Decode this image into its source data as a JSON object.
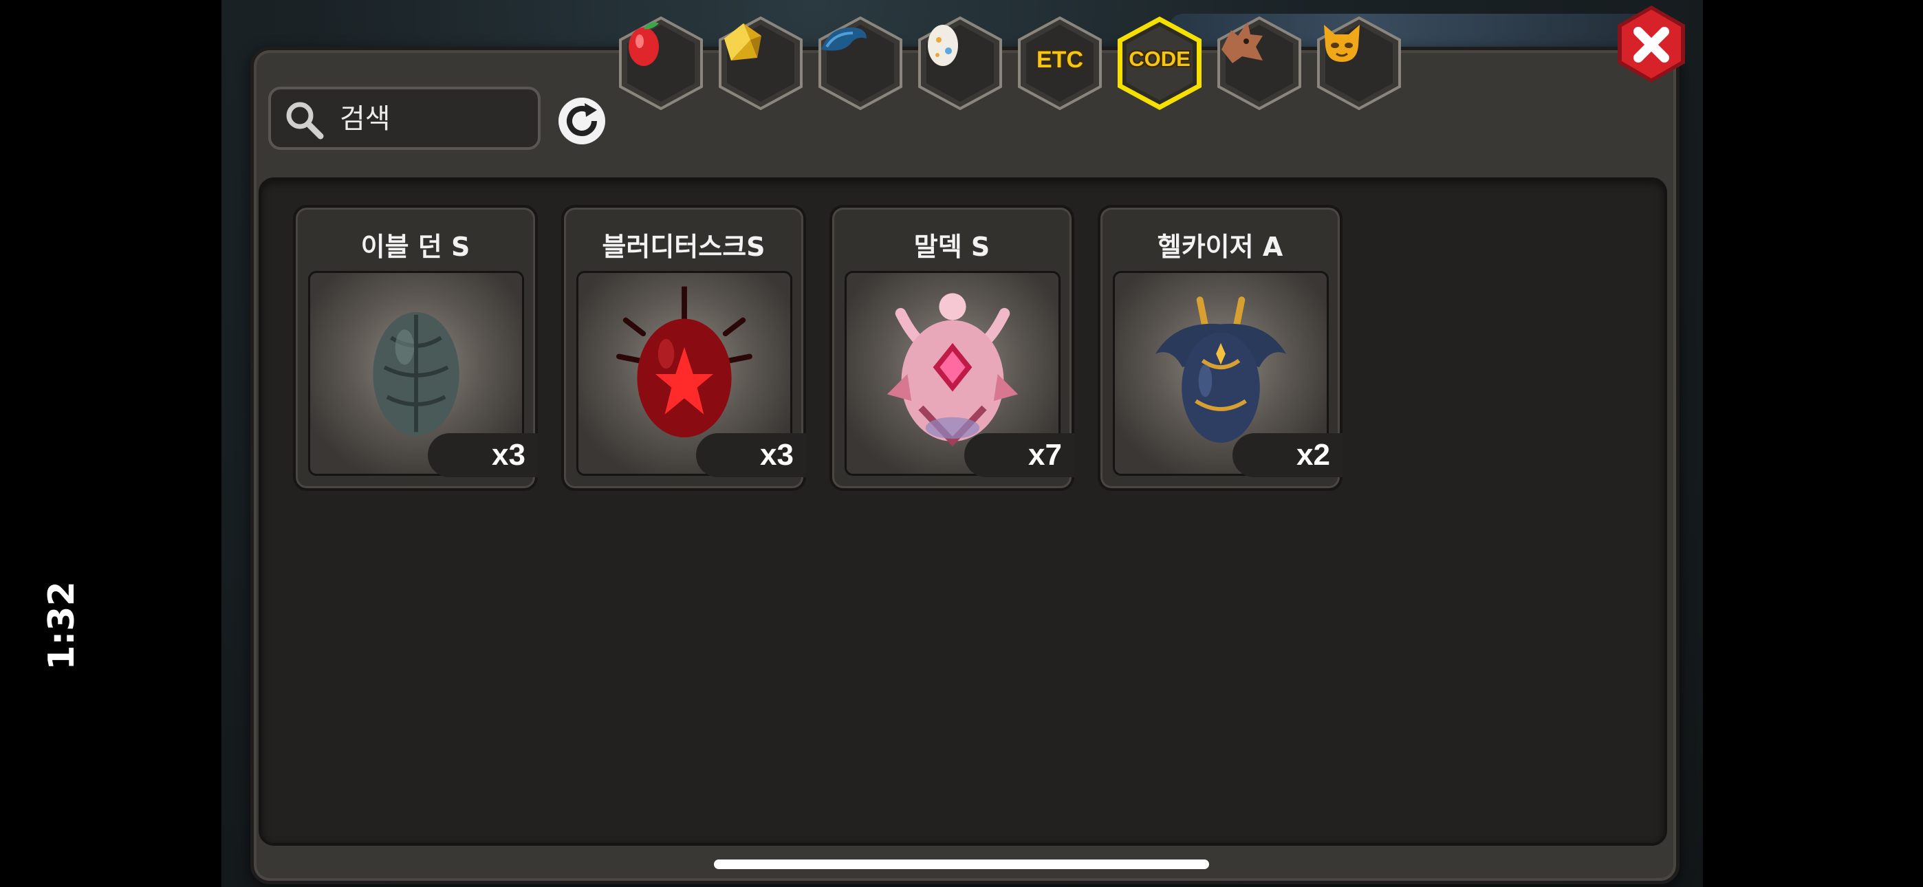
{
  "status_bar": {
    "time": "1:32"
  },
  "search": {
    "placeholder": "검색",
    "value": ""
  },
  "tabs": [
    {
      "name": "fruit",
      "label": "",
      "icon": "fruit-icon",
      "selected": false
    },
    {
      "name": "gold",
      "label": "",
      "icon": "gold-ore-icon",
      "selected": false
    },
    {
      "name": "scale",
      "label": "",
      "icon": "dragon-scale-icon",
      "selected": false
    },
    {
      "name": "egg",
      "label": "",
      "icon": "egg-icon",
      "selected": false
    },
    {
      "name": "etc",
      "label": "ETC",
      "icon": "",
      "selected": false
    },
    {
      "name": "code",
      "label": "CODE",
      "icon": "",
      "selected": true
    },
    {
      "name": "dragon",
      "label": "",
      "icon": "dragon-head-icon",
      "selected": false
    },
    {
      "name": "pet",
      "label": "",
      "icon": "pet-face-icon",
      "selected": false
    }
  ],
  "items": [
    {
      "name": "이블 던 S",
      "count": "x3",
      "icon": "evil-dawn-egg-icon"
    },
    {
      "name": "블러디터스크S",
      "count": "x3",
      "icon": "bloody-tusk-egg-icon"
    },
    {
      "name": "말덱 S",
      "count": "x7",
      "icon": "maldek-egg-icon"
    },
    {
      "name": "헬카이저 A",
      "count": "x2",
      "icon": "hellkaiser-egg-icon"
    }
  ],
  "colors": {
    "selected_tab_border": "#f5e000",
    "tab_fill": "#3a3835",
    "close_red": "#d8222a",
    "label_gold": "#f5c518"
  }
}
